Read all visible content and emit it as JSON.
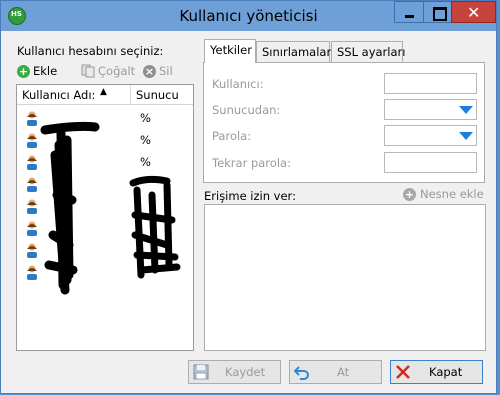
{
  "window": {
    "title": "Kullanıcı yöneticisi",
    "icon_text": "HS",
    "accent_color": "#6e9fd6",
    "close_color": "#c7433b"
  },
  "left": {
    "prompt": "Kullanıcı hesabını seçiniz:",
    "toolbar": {
      "add_label": "Ekle",
      "copy_label": "Çoğalt",
      "delete_label": "Sil"
    },
    "columns": {
      "user": "Kullanıcı Adı:",
      "server": "Sunucu"
    },
    "rows": [
      {
        "server": "%"
      },
      {
        "server": "%"
      },
      {
        "server": "%"
      },
      {
        "server": ""
      },
      {
        "server": ""
      },
      {
        "server": ""
      },
      {
        "server": ""
      },
      {
        "server": ""
      }
    ]
  },
  "tabs": [
    {
      "label": "Yetkiler"
    },
    {
      "label": "Sınırlamalar"
    },
    {
      "label": "SSL ayarları"
    }
  ],
  "form": {
    "user_label": "Kullanıcı:",
    "from_label": "Sunucudan:",
    "password_label": "Parola:",
    "repeat_label": "Tekrar parola:"
  },
  "access": {
    "label": "Erişime izin ver:",
    "add_object_label": "Nesne ekle"
  },
  "buttons": {
    "save": "Kaydet",
    "discard": "At",
    "close": "Kapat"
  }
}
